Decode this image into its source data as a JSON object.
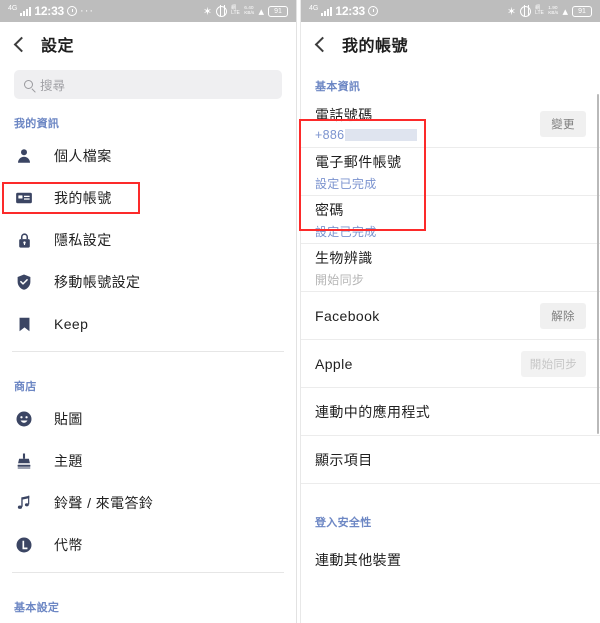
{
  "left_panel": {
    "statusbar": {
      "network_type": "4G",
      "time": "12:33",
      "alarm_icon": "alarm-icon",
      "more_icon": "···",
      "bluetooth_icon": "✶",
      "vpn_icon": "globe-icon",
      "net_label_top": "網",
      "net_label_bottom": "LTE",
      "rate_value": "6.40",
      "rate_unit": "KB/s",
      "wifi_icon": "wifi-icon",
      "battery_percent": "91"
    },
    "header": {
      "back_icon": "back-chevron-icon",
      "title": "設定"
    },
    "search": {
      "icon": "search-icon",
      "placeholder": "搜尋",
      "value": ""
    },
    "sections": [
      {
        "label": "我的資訊",
        "items": [
          {
            "icon": "person-icon",
            "label": "個人檔案"
          },
          {
            "icon": "id-card-icon",
            "label": "我的帳號"
          },
          {
            "icon": "lock-icon",
            "label": "隱私設定"
          },
          {
            "icon": "shield-check-icon",
            "label": "移動帳號設定"
          },
          {
            "icon": "bookmark-icon",
            "label": "Keep"
          }
        ]
      },
      {
        "label": "商店",
        "items": [
          {
            "icon": "smiley-icon",
            "label": "貼圖"
          },
          {
            "icon": "stamp-icon",
            "label": "主題"
          },
          {
            "icon": "music-note-icon",
            "label": "鈴聲 / 來電答鈴"
          },
          {
            "icon": "coin-l-icon",
            "label": "代幣"
          }
        ]
      },
      {
        "label": "基本設定",
        "items": []
      }
    ]
  },
  "right_panel": {
    "statusbar": {
      "network_type": "4G",
      "time": "12:33",
      "alarm_icon": "alarm-icon",
      "bluetooth_icon": "✶",
      "vpn_icon": "globe-icon",
      "net_label_top": "網",
      "net_label_bottom": "LTE",
      "rate_value": "1.90",
      "rate_unit": "KB/s",
      "wifi_icon": "wifi-icon",
      "battery_percent": "91"
    },
    "header": {
      "back_icon": "back-chevron-icon",
      "title": "我的帳號"
    },
    "sections": [
      {
        "label": "基本資訊",
        "rows": [
          {
            "title": "電話號碼",
            "sub": "+886",
            "sub_style": "phone",
            "button": "變更",
            "button_state": "enabled"
          },
          {
            "title": "電子郵件帳號",
            "sub": "設定已完成",
            "sub_style": "blue",
            "button": "",
            "button_state": "none"
          },
          {
            "title": "密碼",
            "sub": "設定已完成",
            "sub_style": "blue",
            "button": "",
            "button_state": "none"
          },
          {
            "title": "生物辨識",
            "sub": "開始同步",
            "sub_style": "gray",
            "button": "",
            "button_state": "none"
          },
          {
            "title": "Facebook",
            "sub": "",
            "sub_style": "none",
            "button": "解除",
            "button_state": "enabled"
          },
          {
            "title": "Apple",
            "sub": "",
            "sub_style": "none",
            "button": "開始同步",
            "button_state": "disabled"
          },
          {
            "title": "連動中的應用程式",
            "sub": "",
            "sub_style": "none",
            "button": "",
            "button_state": "none"
          },
          {
            "title": "顯示項目",
            "sub": "",
            "sub_style": "none",
            "button": "",
            "button_state": "none"
          }
        ]
      },
      {
        "label": "登入安全性",
        "rows": [
          {
            "title": "連動其他裝置",
            "sub": "",
            "sub_style": "none",
            "button": "",
            "button_state": "none"
          }
        ]
      }
    ]
  },
  "annotations": {
    "highlight_color": "#fc2a2a",
    "boxes": [
      {
        "name": "my-account-menu-highlight"
      },
      {
        "name": "basic-info-rows-highlight"
      }
    ]
  }
}
